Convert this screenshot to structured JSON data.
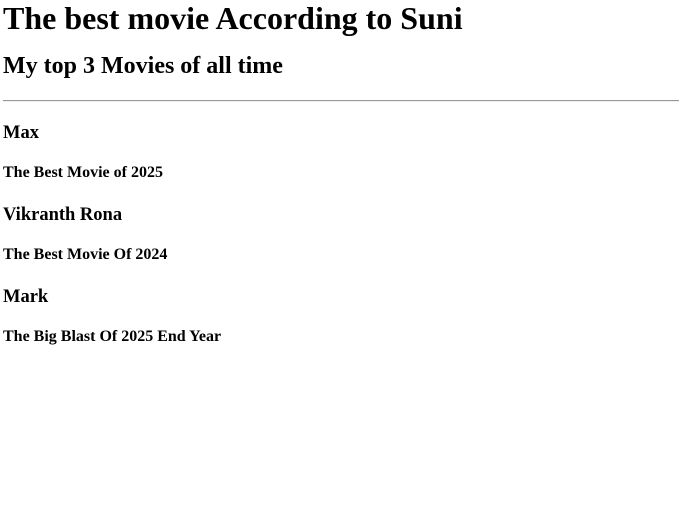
{
  "page": {
    "title": "The best movie According to Suni",
    "subtitle": "My top 3 Movies of all time"
  },
  "movies": [
    {
      "name": "Max",
      "note": "The Best Movie of 2025"
    },
    {
      "name": "Vikranth Rona",
      "note": "The Best Movie Of 2024"
    },
    {
      "name": "Mark",
      "note": "The Big Blast Of 2025 End Year"
    }
  ]
}
